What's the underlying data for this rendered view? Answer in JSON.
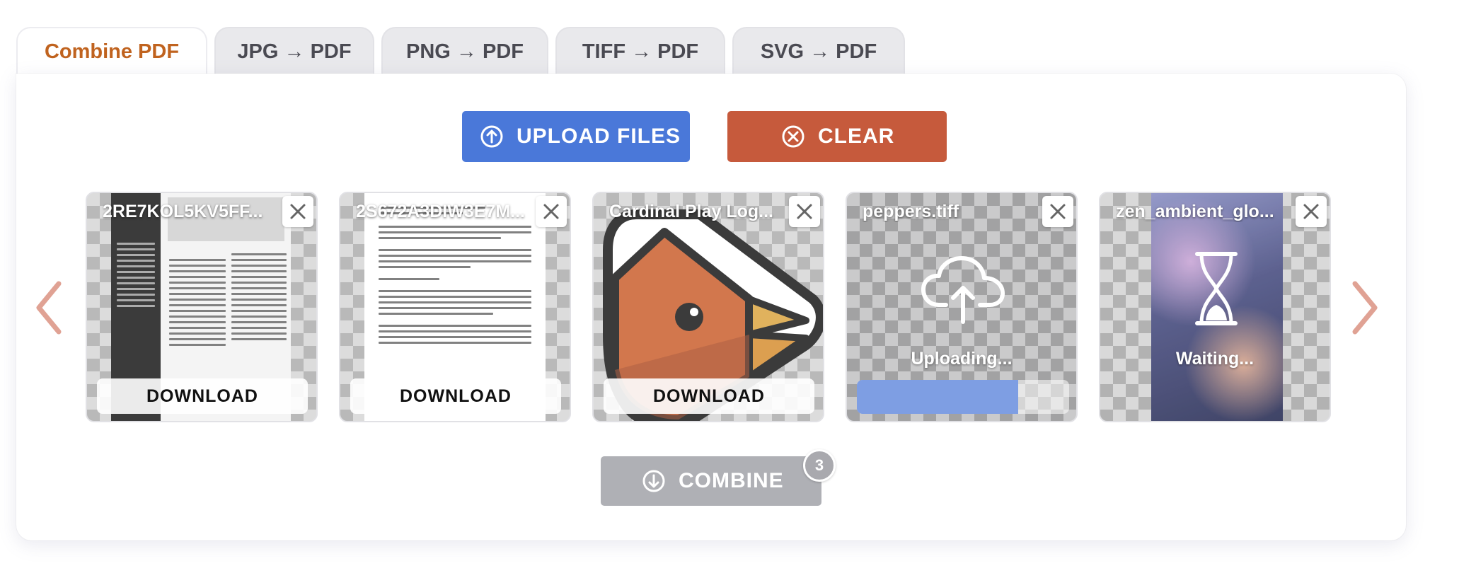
{
  "tabs": [
    {
      "label": "Combine PDF",
      "active": true
    },
    {
      "label": "JPG → PDF",
      "active": false
    },
    {
      "label": "PNG → PDF",
      "active": false
    },
    {
      "label": "TIFF → PDF",
      "active": false
    },
    {
      "label": "SVG → PDF",
      "active": false
    }
  ],
  "toolbar": {
    "upload_label": "UPLOAD FILES",
    "upload_icon": "upload-circle-icon",
    "clear_label": "CLEAR",
    "clear_icon": "close-circle-icon"
  },
  "files": [
    {
      "name": "2RE7KOL5KV5FF...",
      "state": "done",
      "action": "DOWNLOAD"
    },
    {
      "name": "2S672A3DIW3E7M...",
      "state": "done",
      "action": "DOWNLOAD"
    },
    {
      "name": "Cardinal Play Log...",
      "state": "done",
      "action": "DOWNLOAD"
    },
    {
      "name": "peppers.tiff",
      "state": "uploading",
      "status": "Uploading...",
      "progress": 0.76
    },
    {
      "name": "zen_ambient_glo...",
      "state": "waiting",
      "status": "Waiting..."
    }
  ],
  "combine": {
    "label": "COMBINE",
    "count": "3"
  },
  "colors": {
    "accent": "#c0631f",
    "upload": "#4a78d9",
    "clear": "#c65a3c",
    "combine_disabled": "#afb0b5",
    "arrow": "#e0a294"
  }
}
